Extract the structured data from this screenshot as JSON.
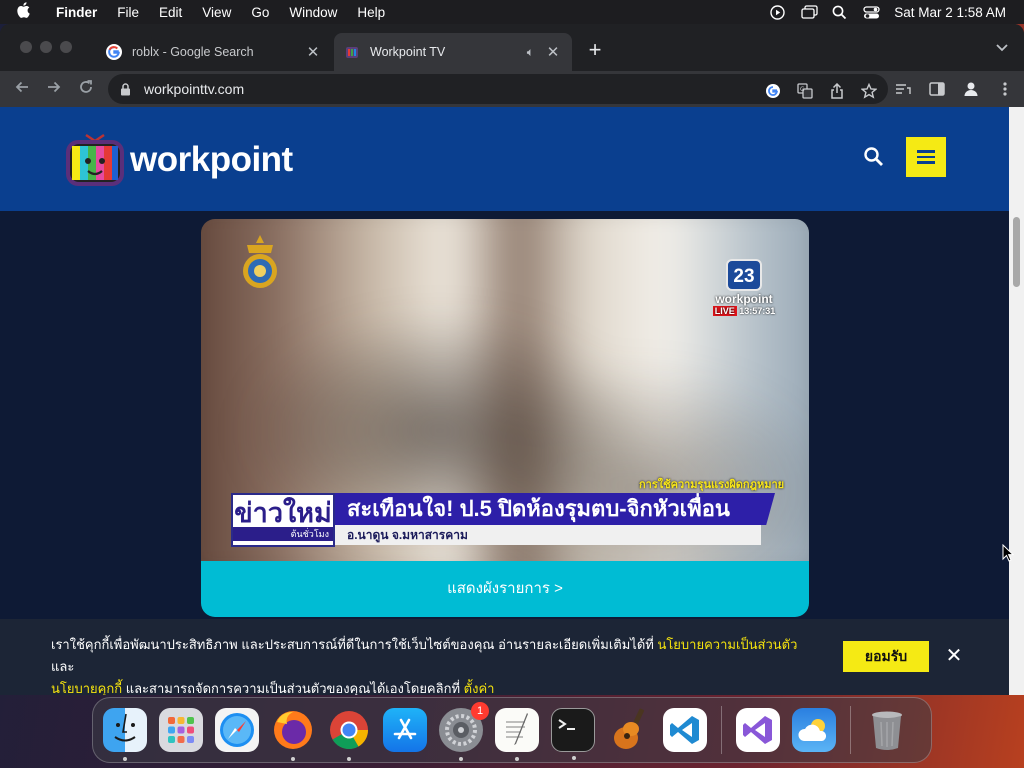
{
  "menubar": {
    "app_name": "Finder",
    "items": [
      "File",
      "Edit",
      "View",
      "Go",
      "Window",
      "Help"
    ],
    "datetime": "Sat Mar 2  1:58 AM"
  },
  "tabs": [
    {
      "title": "roblx - Google Search",
      "active": false,
      "favicon": "google-icon"
    },
    {
      "title": "Workpoint TV",
      "active": true,
      "favicon": "workpoint-icon",
      "audio": true
    }
  ],
  "omnibox": {
    "url": "workpointtv.com"
  },
  "site": {
    "logo_text": "workpoint",
    "accent": "#f5ea14",
    "header_bg": "#0a3f8f"
  },
  "video": {
    "channel_number": "23",
    "channel_name": "workpoint",
    "live_label": "LIVE",
    "live_time": "13:57:31",
    "ticker_small": "การใช้ความรุนแรงผิดกฎหมาย",
    "badge_main": "ข่าวใหม่",
    "badge_sub": "ต้นชั่วโมง",
    "headline": "สะเทือนใจ! ป.5 ปิดห้องรุมตบ-จิกหัวเพื่อน",
    "subline": "อ.นาดูน จ.มหาสารคาม",
    "schedule_button": "แสดงผังรายการ >"
  },
  "cookie": {
    "text_1": "เราใช้คุกกี้เพื่อพัฒนาประสิทธิภาพ และประสบการณ์ที่ดีในการใช้เว็บไซต์ของคุณ อ่านรายละเอียดเพิ่มเติมได้ที่ ",
    "link_privacy": "นโยบายความเป็นส่วนตัว",
    "and": " และ",
    "link_cookie": "นโยบายคุกกี้",
    "text_2": " และสามารถจัดการความเป็นส่วนตัวของคุณได้เองโดยคลิกที่ ",
    "link_settings": "ตั้งค่า",
    "accept_button": "ยอมรับ",
    "close_symbol": "✕"
  },
  "dock": {
    "apps": [
      "finder",
      "launchpad",
      "safari",
      "firefox",
      "chrome",
      "app-store",
      "system-settings",
      "textedit",
      "terminal",
      "garageband",
      "vscode",
      "visual-studio",
      "weather",
      "trash"
    ],
    "system_settings_badge": "1"
  }
}
